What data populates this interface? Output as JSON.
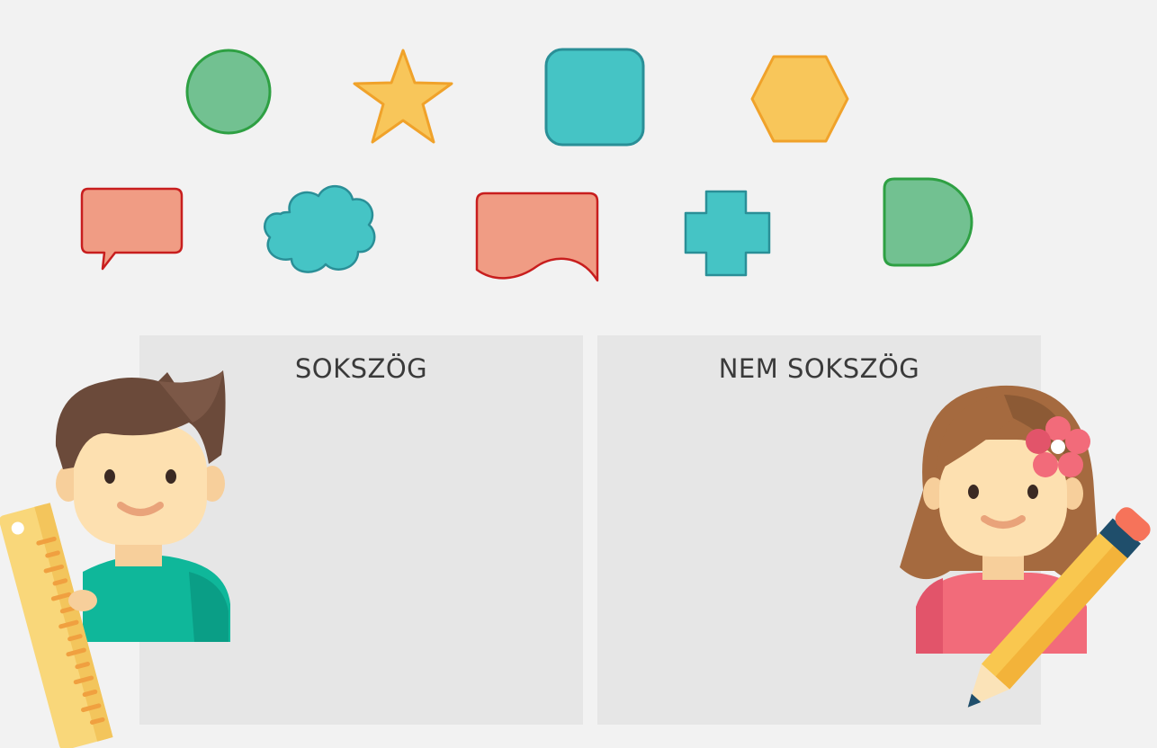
{
  "zones": {
    "left": {
      "label": "SOKSZÖG"
    },
    "right": {
      "label": "NEM SOKSZÖG"
    }
  },
  "shapes": [
    {
      "name": "circle",
      "fill": "#72c191",
      "stroke": "#2ea043"
    },
    {
      "name": "star",
      "fill": "#f8c65a",
      "stroke": "#f0a22a"
    },
    {
      "name": "rounded-square",
      "fill": "#45c4c5",
      "stroke": "#2a8f97"
    },
    {
      "name": "hexagon",
      "fill": "#f8c65a",
      "stroke": "#f0a22a"
    },
    {
      "name": "speech-bubble",
      "fill": "#f09c84",
      "stroke": "#c81e1e"
    },
    {
      "name": "cloud",
      "fill": "#45c4c5",
      "stroke": "#2a8f97"
    },
    {
      "name": "document-wave",
      "fill": "#f09c84",
      "stroke": "#c81e1e"
    },
    {
      "name": "cross",
      "fill": "#45c4c5",
      "stroke": "#2a8f97"
    },
    {
      "name": "d-shape",
      "fill": "#72c191",
      "stroke": "#2ea043"
    }
  ],
  "characters": {
    "boy": {
      "tool": "ruler",
      "shirt": "#0fb79a",
      "hair": "#6b4a3a"
    },
    "girl": {
      "tool": "pencil",
      "shirt": "#f26b7a",
      "hair": "#a56a3f"
    }
  }
}
